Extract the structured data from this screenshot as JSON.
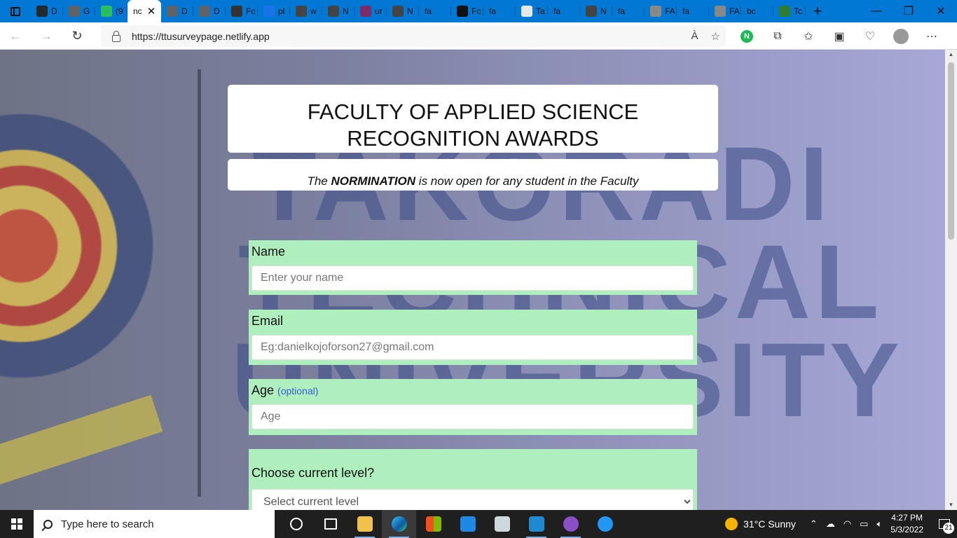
{
  "browser": {
    "tabs": [
      {
        "label": "D",
        "icon": "github-icon",
        "color": "#24292e"
      },
      {
        "label": "G",
        "icon": "document-icon",
        "color": "#5f6368"
      },
      {
        "label": "(9",
        "icon": "chat-icon",
        "color": "#2bbf5b"
      },
      {
        "label": "nc",
        "icon": "",
        "color": "#ffffff",
        "active": true
      },
      {
        "label": "D",
        "icon": "document-icon",
        "color": "#5f6368"
      },
      {
        "label": "D",
        "icon": "document-icon",
        "color": "#5f6368"
      },
      {
        "label": "Fc",
        "icon": "codepen-icon",
        "color": "#333333"
      },
      {
        "label": "pl",
        "icon": "bing-icon",
        "color": "#1a73e8"
      },
      {
        "label": "w",
        "icon": "puzzle-icon",
        "color": "#444444"
      },
      {
        "label": "N",
        "icon": "mail-icon",
        "color": "#444444"
      },
      {
        "label": "ur",
        "icon": "video-icon",
        "color": "#7b2d6b"
      },
      {
        "label": "N",
        "icon": "mail-icon",
        "color": "#444444"
      },
      {
        "label": "fa",
        "icon": "",
        "color": "#0078d4"
      },
      {
        "label": "Fc",
        "icon": "codepen-icon",
        "color": "#111111"
      },
      {
        "label": "fa",
        "icon": "",
        "color": "#0078d4"
      },
      {
        "label": "Ta",
        "icon": "wordpress-icon",
        "color": "#e6e6e6"
      },
      {
        "label": "fa",
        "icon": "",
        "color": "#0078d4"
      },
      {
        "label": "N",
        "icon": "mail-icon",
        "color": "#444444"
      },
      {
        "label": "fa",
        "icon": "",
        "color": "#0078d4"
      },
      {
        "label": "FA",
        "icon": "globe-icon",
        "color": "#888888"
      },
      {
        "label": "fa",
        "icon": "",
        "color": "#0078d4"
      },
      {
        "label": "FA",
        "icon": "globe-icon",
        "color": "#888888"
      },
      {
        "label": "bc",
        "icon": "",
        "color": "#0078d4"
      },
      {
        "label": "Tc",
        "icon": "leaf-icon",
        "color": "#2e7d32"
      }
    ],
    "active_close": "✕",
    "new_tab": "+",
    "window_controls": {
      "minimize": "—",
      "restore": "❐",
      "close": "✕"
    },
    "url": "https://ttusurveypage.netlify.app",
    "read_aloud": "À",
    "ext_badge": "N"
  },
  "page": {
    "title_line1": "FACULTY OF APPLIED SCIENCE",
    "title_line2": "RECOGNITION AWARDS",
    "subtitle_pre": "The ",
    "subtitle_bold": "NORMINATION",
    "subtitle_post": " is now open for any student in the Faculty",
    "background_words": [
      "TAKORADI",
      "TECHNICAL",
      "UNIVERSITY"
    ],
    "form": {
      "name_label": "Name",
      "name_placeholder": "Enter your name",
      "email_label": "Email",
      "email_placeholder": "Eg:danielkojoforson27@gmail.com",
      "age_label": "Age",
      "age_optional": "(optional)",
      "age_placeholder": "Age",
      "level_label": "Choose current level?",
      "level_selected": "Select current level"
    },
    "colors": {
      "field_bg": "#aeefbd",
      "optional_text": "#3b5bd6"
    }
  },
  "taskbar": {
    "search_placeholder": "Type here to search",
    "weather": "31°C  Sunny",
    "time": "4:27 PM",
    "date": "5/3/2022",
    "notifications": "21"
  }
}
